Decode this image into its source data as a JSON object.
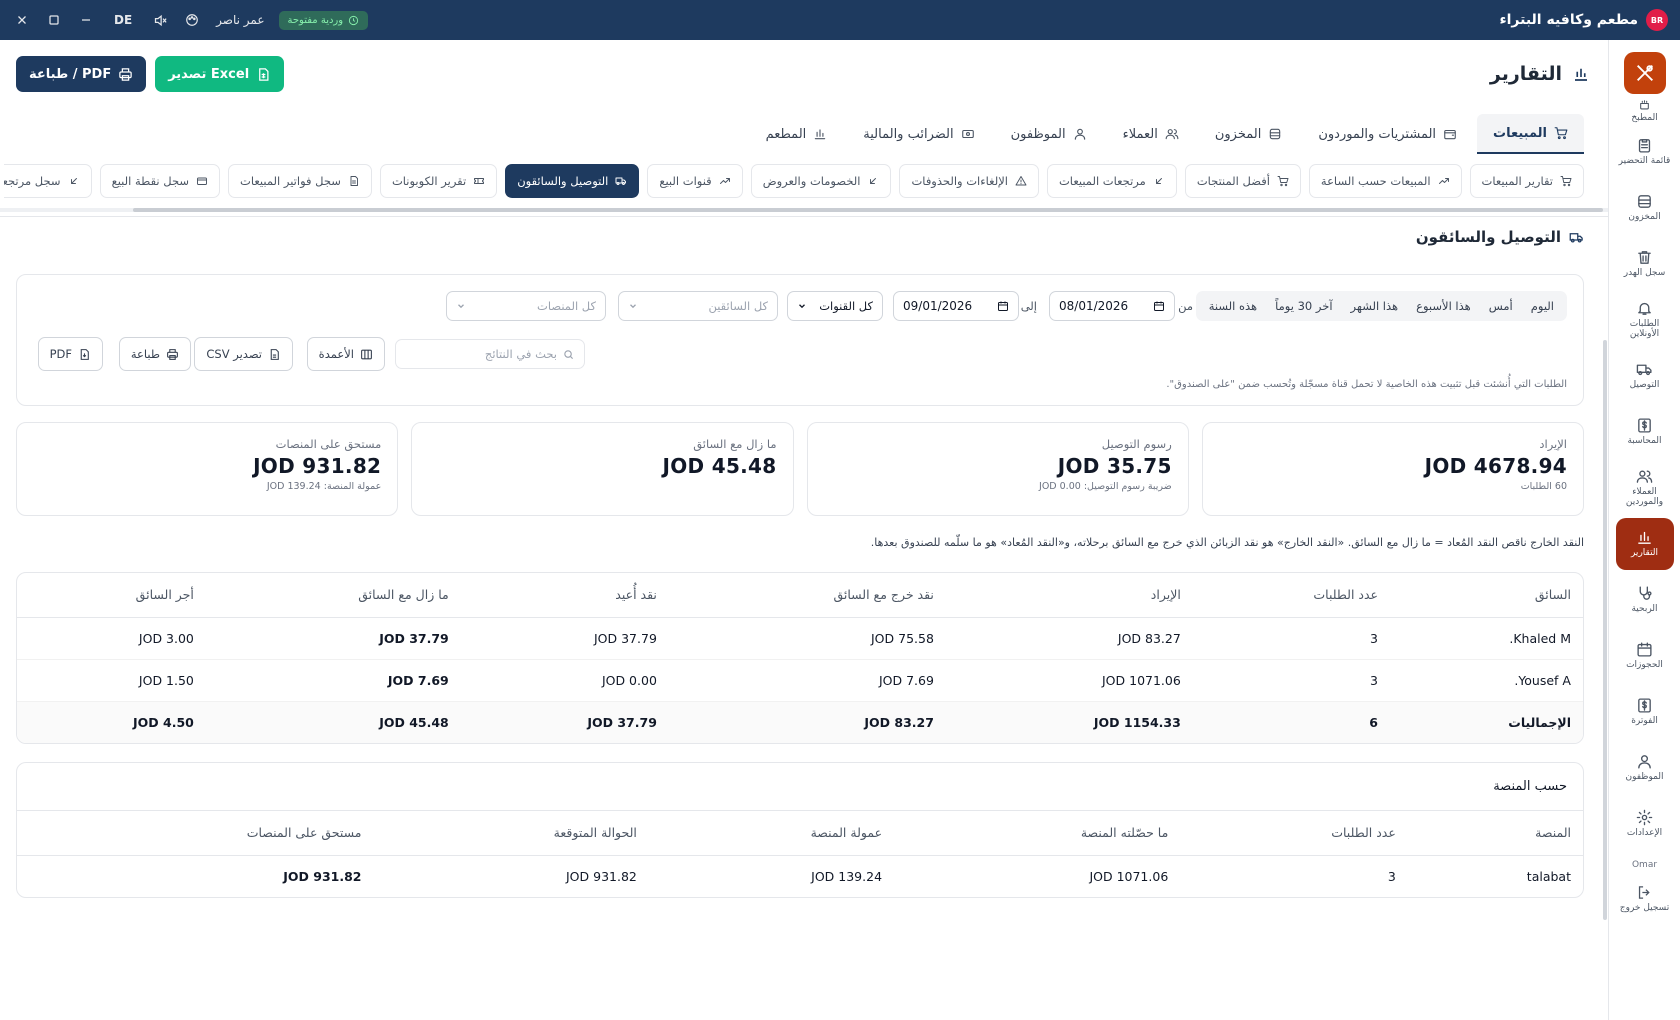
{
  "topbar": {
    "app_name": "مطعم وكافيه البتراء",
    "logo_text": "BR",
    "shift_badge": "وردية مفتوحة",
    "user": "عمر ناصر",
    "lang": "DE"
  },
  "sidebar": {
    "items": [
      {
        "label": "المطبخ",
        "icon": "kitchen-icon"
      },
      {
        "label": "قائمة التحضير",
        "icon": "clipboard-icon"
      },
      {
        "label": "المخزون",
        "icon": "inventory-icon"
      },
      {
        "label": "سجل الهدر",
        "icon": "trash-icon"
      },
      {
        "label": "الطلبات الأونلاين",
        "icon": "bell-icon"
      },
      {
        "label": "التوصيل",
        "icon": "truck-icon"
      },
      {
        "label": "المحاسبة",
        "icon": "dollar-icon"
      },
      {
        "label": "العملاء والموردين",
        "icon": "users-icon"
      },
      {
        "label": "التقارير",
        "icon": "chart-icon",
        "active": true
      },
      {
        "label": "الربحية",
        "icon": "stethoscope-icon"
      },
      {
        "label": "الحجوزات",
        "icon": "calendar-icon"
      },
      {
        "label": "الفوترة",
        "icon": "invoice-icon"
      },
      {
        "label": "الموظفون",
        "icon": "people-icon"
      },
      {
        "label": "الإعدادات",
        "icon": "gear-icon"
      }
    ],
    "user": "Omar",
    "logout": "تسجيل خروج"
  },
  "header": {
    "title": "التقارير",
    "export_excel": "تصدير Excel",
    "print_pdf": "طباعة / PDF"
  },
  "main_tabs": [
    "المبيعات",
    "المشتريات والموردون",
    "المخزون",
    "العملاء",
    "الموظفون",
    "الضرائب والمالية",
    "المطعم"
  ],
  "sub_tabs": [
    "تقارير المبيعات",
    "المبيعات حسب الساعة",
    "أفضل المنتجات",
    "مرتجعات المبيعات",
    "الإلغاءات والحذوفات",
    "الخصومات والعروض",
    "قنوات البيع",
    "التوصيل والسائقون",
    "تقرير الكوبونات",
    "سجل فواتير المبيعات",
    "سجل نقطة البيع",
    "سجل مرتجعات المبيعات"
  ],
  "section": {
    "title": "التوصيل والسائقون"
  },
  "filters": {
    "periods": [
      "اليوم",
      "أمس",
      "هذا الأسبوع",
      "هذا الشهر",
      "آخر 30 يوماً",
      "هذه السنة"
    ],
    "from_label": "من",
    "from_date": "08/01/2026",
    "to_label": "إلى",
    "to_date": "09/01/2026",
    "channels": "كل القنوات",
    "drivers_placeholder": "كل السائقين",
    "platforms_placeholder": "كل المنصات",
    "search_placeholder": "بحث في النتائج",
    "columns_btn": "الأعمدة",
    "csv_btn": "تصدير CSV",
    "print_btn": "طباعة",
    "pdf_btn": "PDF",
    "note": "الطلبات التي أُنشئت قبل تثبيت هذه الخاصية لا تحمل قناة مسجّلة وتُحسب ضمن \"على الصندوق\"."
  },
  "stats": [
    {
      "label": "الإيراد",
      "value": "JOD 4678.94",
      "sub": "60 الطلبات"
    },
    {
      "label": "رسوم التوصيل",
      "value": "JOD 35.75",
      "sub": "ضريبة رسوم التوصيل: JOD 0.00"
    },
    {
      "label": "ما زال مع السائق",
      "value": "JOD 45.48",
      "sub": ""
    },
    {
      "label": "مستحق على المنصات",
      "value": "JOD 931.82",
      "sub": "عمولة المنصة: JOD 139.24"
    }
  ],
  "explain": "النقد الخارج ناقص النقد المُعاد = ما زال مع السائق. «النقد الخارج» هو نقد الزبائن الذي خرج مع السائق برحلاته، و«النقد المُعاد» هو ما سلّمه للصندوق بعدها.",
  "drivers_table": {
    "headers": [
      "السائق",
      "عدد الطلبات",
      "الإيراد",
      "نقد خرج مع السائق",
      "نقد أُعيد",
      "ما زال مع السائق",
      "أجر السائق"
    ],
    "rows": [
      [
        "Khaled M.",
        "3",
        "JOD 83.27",
        "JOD 75.58",
        "JOD 37.79",
        "JOD 37.79",
        "JOD 3.00"
      ],
      [
        "Yousef A.",
        "3",
        "JOD 1071.06",
        "JOD 7.69",
        "JOD 0.00",
        "JOD 7.69",
        "JOD 1.50"
      ]
    ],
    "totals": [
      "الإجماليات",
      "6",
      "JOD 1154.33",
      "JOD 83.27",
      "JOD 37.79",
      "JOD 45.48",
      "JOD 4.50"
    ]
  },
  "platform_table": {
    "title": "حسب المنصة",
    "headers": [
      "المنصة",
      "عدد الطلبات",
      "ما حصّلته المنصة",
      "عمولة المنصة",
      "الحوالة المتوقعة",
      "مستحق على المنصات"
    ],
    "rows": [
      [
        "talabat",
        "3",
        "JOD 1071.06",
        "JOD 139.24",
        "JOD 931.82",
        "JOD 931.82"
      ]
    ]
  },
  "colors": {
    "navy": "#1e3a5f",
    "green": "#10b981",
    "accent": "#9f2d12"
  }
}
